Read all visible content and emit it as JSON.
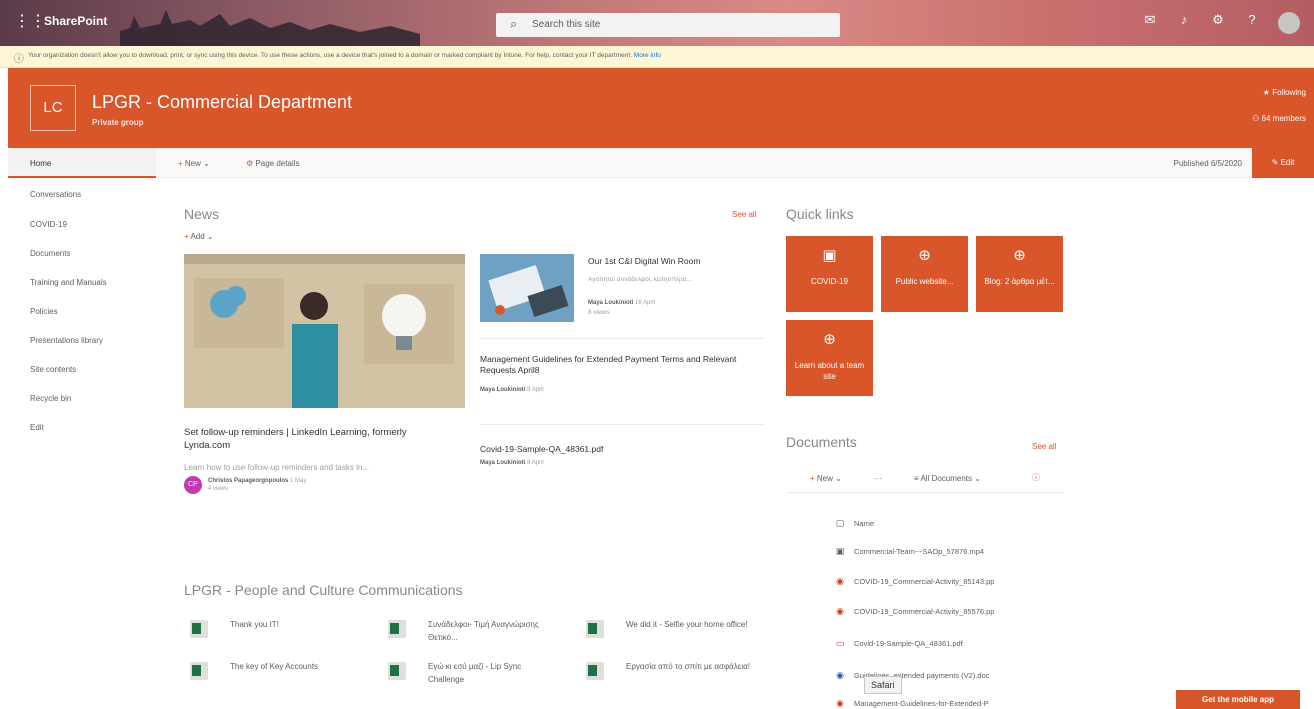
{
  "suitebar": {
    "brand": "SharePoint",
    "search_placeholder": "Search this site"
  },
  "notice": {
    "text": "Your organization doesn't allow you to download, print, or sync using this device. To use these actions, use a device that's joined to a domain or marked compliant by Intune. For help, contact your IT department.",
    "link": "More info"
  },
  "site": {
    "logo": "LC",
    "title": "LPGR - Commercial Department",
    "subtitle": "Private group",
    "following": "Following",
    "members": "64 members"
  },
  "cmdbar": {
    "home": "Home",
    "new": "New",
    "page_details": "Page details",
    "published": "Published 6/5/2020",
    "edit": "Edit"
  },
  "nav": [
    "Conversations",
    "COVID-19",
    "Documents",
    "Training and Manuals",
    "Policies",
    "Presentations library",
    "Site contents",
    "Recycle bin",
    "Edit"
  ],
  "news": {
    "title": "News",
    "see_all": "See all",
    "add": "Add",
    "featured": {
      "title": "Set follow-up reminders | LinkedIn Learning, formerly Lynda.com",
      "desc": "Learn how to use follow-up reminders and tasks in...",
      "author_initials": "CP",
      "author": "Christos Papageorgopoulos",
      "date": "1 May",
      "views": "4 views"
    },
    "items": [
      {
        "title": "Our 1st C&I Digital Win Room",
        "sub": "Αγαπητοί συνάδελφοι, καλησπέρα...",
        "author": "Maya Loukinioti",
        "date": "16 April",
        "views": "8 views"
      },
      {
        "title": "Management Guidelines for Extended Payment Terms and Relevant Requests April8",
        "author": "Maya Loukinioti",
        "date": "8 April"
      },
      {
        "title": "Covid-19-Sample-QA_48361.pdf",
        "author": "Maya Loukinioti",
        "date": "8 April"
      }
    ]
  },
  "quicklinks": {
    "title": "Quick links",
    "tiles": [
      {
        "label": "COVID-19",
        "icon": "powerpoint-icon"
      },
      {
        "label": "Public website...",
        "icon": "globe-icon"
      },
      {
        "label": "Blog: 2 άρθρα μέτ...",
        "icon": "globe-icon"
      },
      {
        "label": "Learn about a team site",
        "icon": "globe-icon"
      }
    ]
  },
  "documents": {
    "title": "Documents",
    "see_all": "See all",
    "new": "New",
    "view": "All Documents",
    "header": "Name",
    "rows": [
      {
        "name": "Commercial-Team---SAOp_57876.mp4",
        "type": "video"
      },
      {
        "name": "COVID-19_Commercial-Activity_85143.pp",
        "type": "ppt"
      },
      {
        "name": "COVID-19_Commercial-Activity_85576.pp",
        "type": "ppt"
      },
      {
        "name": "Covid-19-Sample-QA_48361.pdf",
        "type": "pdf"
      },
      {
        "name": "Guidelines_extended payments (V2).doc",
        "type": "doc"
      },
      {
        "name": "Management-Guidelines-for-Extended-P",
        "type": "ppt"
      }
    ]
  },
  "pc": {
    "title": "LPGR - People and Culture Communications",
    "items": [
      "Thank you IT!",
      "Συνάδελφοι- Τιμή Αναγνώρισης Θετικό...",
      "We did it - Selfie your home office!",
      "The key of Key Accounts",
      "Εγώ κι εσύ μαζί - Lip Sync Challenge",
      "Εργασία από το σπίτι με ασφάλεια!"
    ]
  },
  "overlay": {
    "safari": "Safari",
    "mobile_app": "Get the mobile app"
  }
}
